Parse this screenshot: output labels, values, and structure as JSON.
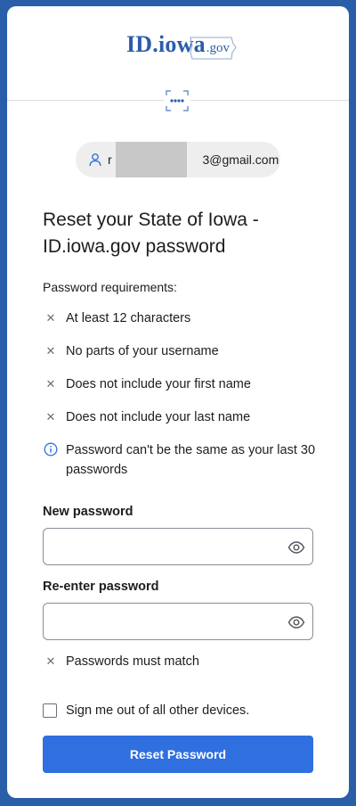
{
  "brand": {
    "logo_main": "ID.iowa",
    "logo_sub": ".gov"
  },
  "user": {
    "email_prefix": "r",
    "email_suffix": "3@gmail.com"
  },
  "heading": "Reset your State of Iowa - ID.iowa.gov password",
  "requirements": {
    "title": "Password requirements:",
    "items": [
      {
        "icon": "x-icon",
        "text": "At least 12 characters"
      },
      {
        "icon": "x-icon",
        "text": "No parts of your username"
      },
      {
        "icon": "x-icon",
        "text": "Does not include your first name"
      },
      {
        "icon": "x-icon",
        "text": "Does not include your last name"
      },
      {
        "icon": "info-icon",
        "text": "Password can't be the same as your last 30 passwords"
      }
    ]
  },
  "new_password": {
    "label": "New password",
    "value": ""
  },
  "reenter_password": {
    "label": "Re-enter password",
    "value": ""
  },
  "match_text": "Passwords must match",
  "signout_label": "Sign me out of all other devices.",
  "submit_label": "Reset Password",
  "colors": {
    "primary": "#2f6fdf",
    "brand": "#2a5ea8"
  }
}
